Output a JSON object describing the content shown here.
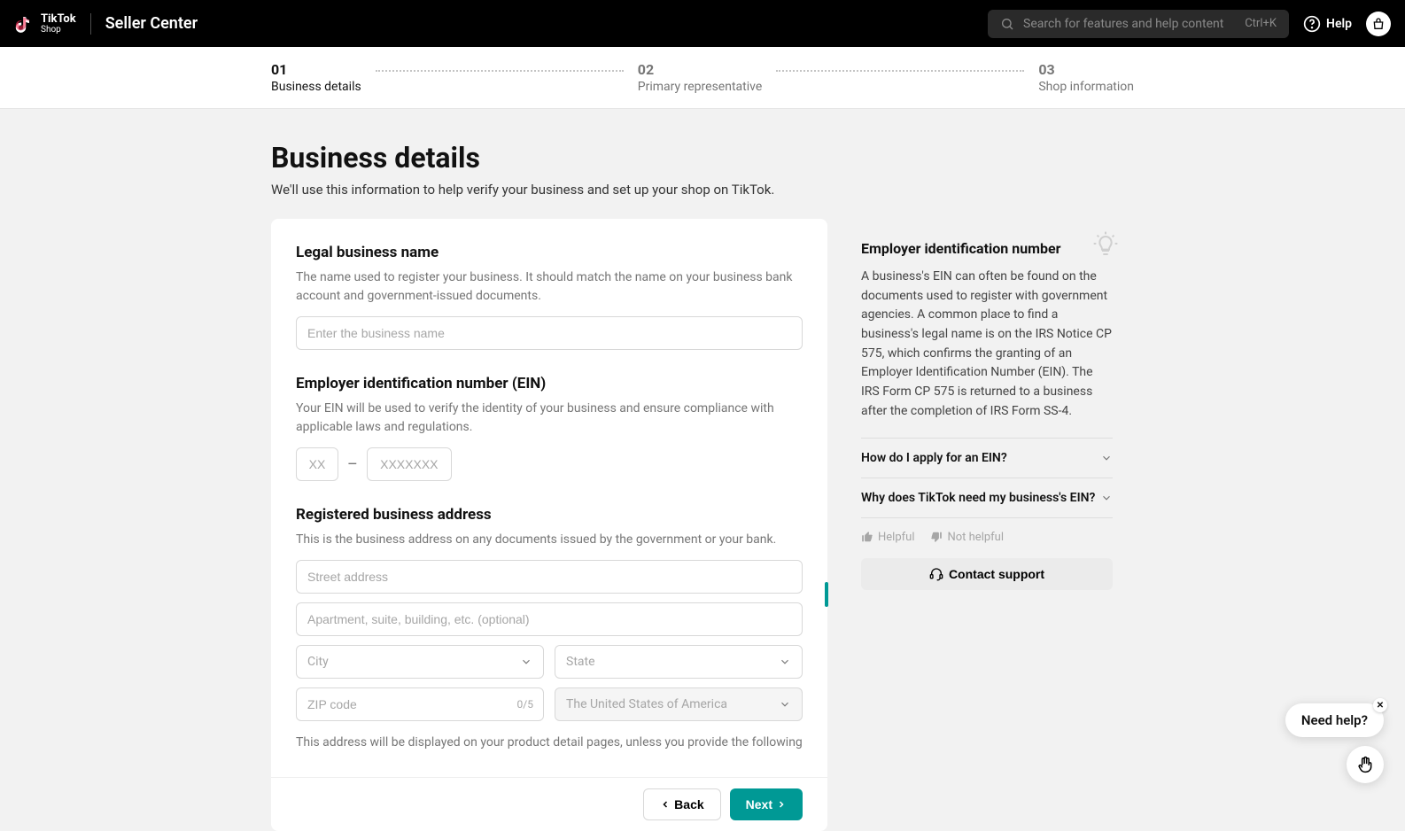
{
  "header": {
    "brand_top": "TikTok",
    "brand_sub": "Shop",
    "app_title": "Seller Center",
    "search_placeholder": "Search for features and help content",
    "search_shortcut": "Ctrl+K",
    "help_label": "Help"
  },
  "steps": [
    {
      "num": "01",
      "label": "Business details"
    },
    {
      "num": "02",
      "label": "Primary representative"
    },
    {
      "num": "03",
      "label": "Shop information"
    }
  ],
  "page": {
    "title": "Business details",
    "subtitle": "We'll use this information to help verify your business and set up your shop on TikTok."
  },
  "form": {
    "legal_name": {
      "title": "Legal business name",
      "desc": "The name used to register your business. It should match the name on your business bank account and government-issued documents.",
      "placeholder": "Enter the business name"
    },
    "ein": {
      "title": "Employer identification number (EIN)",
      "desc": "Your EIN will be used to verify the identity of your business and ensure compliance with applicable laws and regulations.",
      "ph1": "XX",
      "dash": "–",
      "ph2": "XXXXXXX"
    },
    "address": {
      "title": "Registered business address",
      "desc": "This is the business address on any documents issued by the government or your bank.",
      "street_ph": "Street address",
      "apt_ph": "Apartment, suite, building, etc. (optional)",
      "city_ph": "City",
      "state_ph": "State",
      "zip_ph": "ZIP code",
      "zip_count": "0/5",
      "country": "The United States of America",
      "note": "This address will be displayed on your product detail pages, unless you provide the following"
    }
  },
  "sidebar": {
    "title": "Employer identification number",
    "body": "A business's EIN can often be found on the documents used to register with government agencies. A common place to find a business's legal name is on the IRS Notice CP 575, which confirms the granting of an Employer Identification Number (EIN). The IRS Form CP 575 is returned to a business after the completion of IRS Form SS-4.",
    "faq1": "How do I apply for an EIN?",
    "faq2": "Why does TikTok need my business's EIN?",
    "helpful": "Helpful",
    "not_helpful": "Not helpful",
    "contact": "Contact support"
  },
  "footer": {
    "back": "Back",
    "next": "Next"
  },
  "float": {
    "need_help": "Need help?"
  }
}
